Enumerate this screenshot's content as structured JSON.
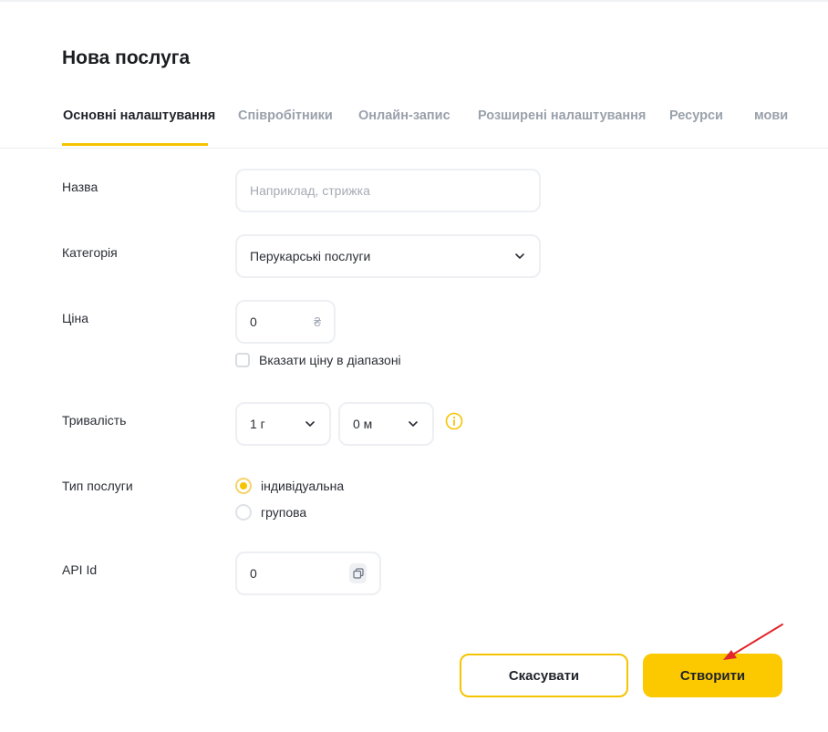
{
  "title": "Нова послуга",
  "tabs": [
    {
      "label": "Основні налаштування",
      "active": true
    },
    {
      "label": "Співробітники",
      "active": false
    },
    {
      "label": "Онлайн-запис",
      "active": false
    },
    {
      "label": "Розширені налаштування",
      "active": false
    },
    {
      "label": "Ресурси",
      "active": false
    },
    {
      "label": "мови",
      "active": false
    }
  ],
  "form": {
    "name": {
      "label": "Назва",
      "value": "",
      "placeholder": "Наприклад, стрижка"
    },
    "category": {
      "label": "Категорія",
      "value": "Перукарські послуги",
      "icon": "chevron-down-icon"
    },
    "price": {
      "label": "Ціна",
      "value": "0",
      "currency": "₴"
    },
    "price_range": {
      "label": "Вказати ціну в діапазоні",
      "checked": false
    },
    "duration": {
      "label": "Тривалість",
      "hours": "1 г",
      "minutes": "0 м",
      "info_icon": "info-icon"
    },
    "service_type": {
      "label": "Тип послуги",
      "options": [
        {
          "label": "індивідуальна",
          "checked": true
        },
        {
          "label": "групова",
          "checked": false
        }
      ]
    },
    "api_id": {
      "label": "API Id",
      "value": "0",
      "icon": "copy-icon"
    }
  },
  "actions": {
    "cancel_label": "Скасувати",
    "create_label": "Створити"
  },
  "colors": {
    "accent": "#fcc800",
    "annotation_arrow": "#e3262b"
  }
}
